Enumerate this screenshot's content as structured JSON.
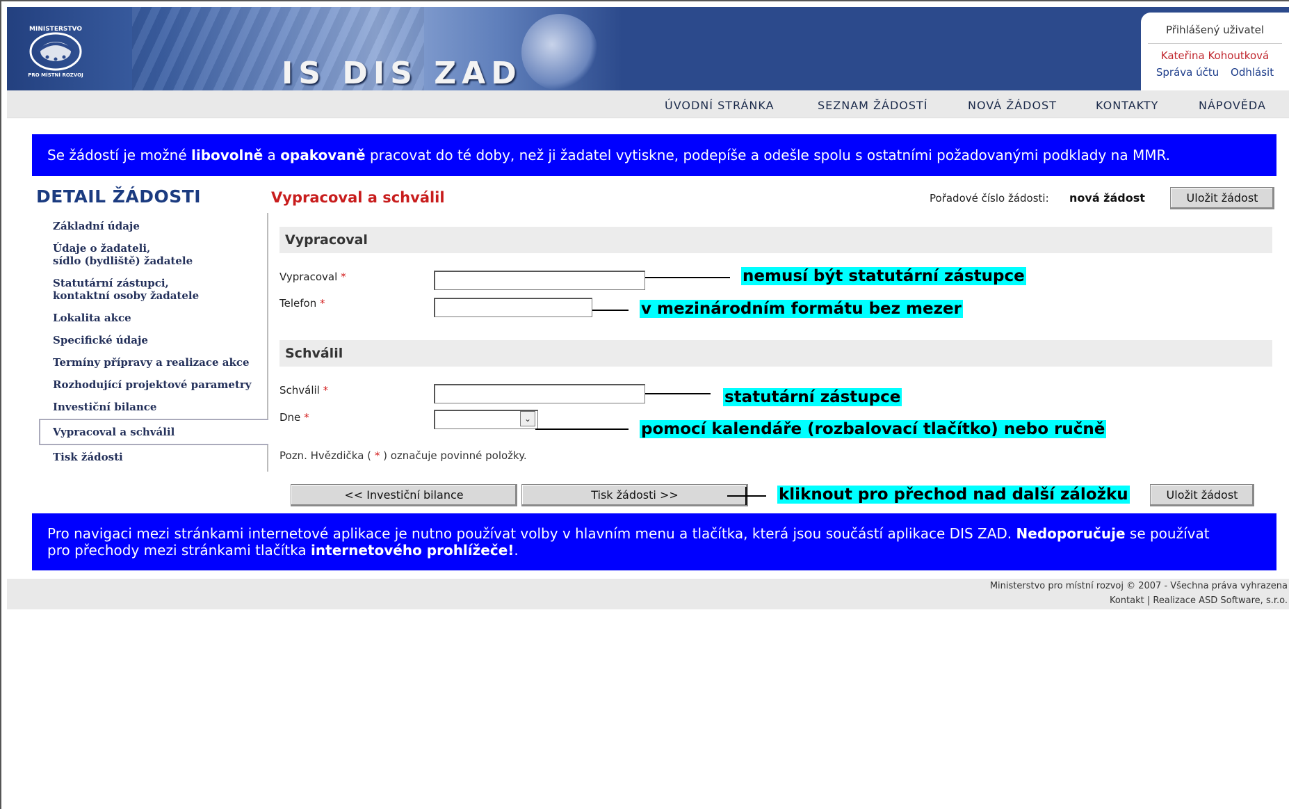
{
  "header": {
    "app_name": "IS DIS ZAD",
    "logo_text_top": "MINISTERSTVO",
    "logo_text_bottom": "PRO MÍSTNÍ ROZVOJ",
    "user_box": {
      "title": "Přihlášený uživatel",
      "user_name": "Kateřina Kohoutková",
      "account_link": "Správa účtu",
      "logout_link": "Odhlásit"
    }
  },
  "menu": [
    "ÚVODNÍ STRÁNKA",
    "SEZNAM ŽÁDOSTÍ",
    "NOVÁ ŽÁDOST",
    "KONTAKTY",
    "NÁPOVĚDA"
  ],
  "info_top": {
    "t1": "Se žádostí je možné ",
    "b1": "libovolně",
    "t2": " a ",
    "b2": "opakovaně",
    "t3": " pracovat do té doby, než ji žadatel vytiskne, podepíše a odešle spolu s ostatními požadovanými podklady na MMR."
  },
  "sidebar": {
    "title": "DETAIL ŽÁDOSTI",
    "items": [
      {
        "line1": "Základní údaje",
        "line2": ""
      },
      {
        "line1": "Údaje o žadateli,",
        "line2": "sídlo (bydliště) žadatele"
      },
      {
        "line1": "Statutární zástupci,",
        "line2": "kontaktní osoby žadatele"
      },
      {
        "line1": "Lokalita akce",
        "line2": ""
      },
      {
        "line1": "Specifické údaje",
        "line2": ""
      },
      {
        "line1": "Termíny přípravy a realizace akce",
        "line2": ""
      },
      {
        "line1": "Rozhodující projektové parametry",
        "line2": ""
      },
      {
        "line1": "Investiční bilance",
        "line2": ""
      },
      {
        "line1": "Vypracoval a schválil",
        "line2": ""
      },
      {
        "line1": "Tisk žádosti",
        "line2": ""
      }
    ]
  },
  "main": {
    "section_title": "Vypracoval a schválil",
    "order_label": "Pořadové číslo žádosti:",
    "order_value": "nová žádost",
    "save_label": "Uložit žádost",
    "group1": "Vypracoval",
    "group2": "Schválil",
    "fields": {
      "prepared_by": {
        "label": "Vypracoval",
        "value": ""
      },
      "phone": {
        "label": "Telefon",
        "value": ""
      },
      "approved_by": {
        "label": "Schválil",
        "value": ""
      },
      "date": {
        "label": "Dne",
        "value": ""
      }
    },
    "required_mark": "*",
    "note_prefix": "Pozn. Hvězdička ( ",
    "note_suffix": " ) označuje povinné položky.",
    "prev_button": "<<  Investiční bilance",
    "next_button": "Tisk žádosti  >>"
  },
  "callouts": {
    "prepared_by": "nemusí být statutární zástupce",
    "phone": "v mezinárodním formátu bez mezer",
    "approved_by": "statutární zástupce",
    "date": "pomocí kalendáře (rozbalovací tlačítko) nebo ručně",
    "next": "kliknout pro přechod nad další záložku"
  },
  "info_bottom": {
    "t1": "Pro navigaci mezi stránkami internetové aplikace je nutno používat volby v hlavním menu a tlačítka, která jsou součástí aplikace DIS ZAD. ",
    "b1": "Nedoporučuje",
    "t2": " se používat",
    "t3": "pro přechody mezi stránkami tlačítka ",
    "b2": "internetového prohlížeče!",
    "t4": "."
  },
  "footer": {
    "line1": "Ministerstvo pro místní rozvoj © 2007 - Všechna práva vyhrazena",
    "contact": "Kontakt",
    "separator": " | ",
    "realization": "Realizace ASD Software, s.r.o."
  },
  "colors": {
    "header_blue": "#2c4a8c",
    "info_bar": "#0000ff",
    "section_title": "#c81d1d",
    "callout_highlight": "#00ffff"
  }
}
